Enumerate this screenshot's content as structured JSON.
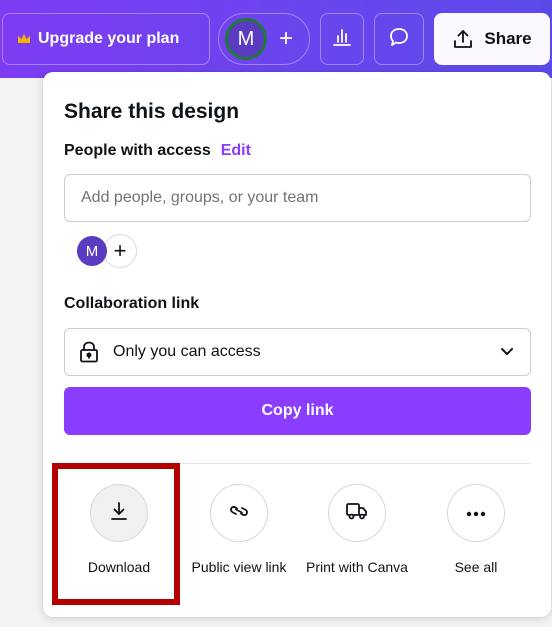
{
  "topbar": {
    "upgrade_label": "Upgrade your plan",
    "avatar_initial": "M",
    "avatar_add": "+",
    "share_label": "Share",
    "gradient_colors": [
      "#7d3cf2",
      "#5c4ae8"
    ]
  },
  "share_panel": {
    "title": "Share this design",
    "people_access_label": "People with access",
    "edit_label": "Edit",
    "add_people_placeholder": "Add people, groups, or your team",
    "member_initial": "M",
    "member_add": "+",
    "collaboration_label": "Collaboration link",
    "access_option": "Only you can access",
    "copy_link_label": "Copy link",
    "accent_color": "#8b3dff"
  },
  "actions": [
    {
      "label": "Download",
      "icon": "download-icon"
    },
    {
      "label": "Public view link",
      "icon": "link-icon"
    },
    {
      "label": "Print with Canva",
      "icon": "truck-icon"
    },
    {
      "label": "See all",
      "icon": "more-icon"
    }
  ],
  "highlight": {
    "target": "Download",
    "color": "#b30000"
  }
}
